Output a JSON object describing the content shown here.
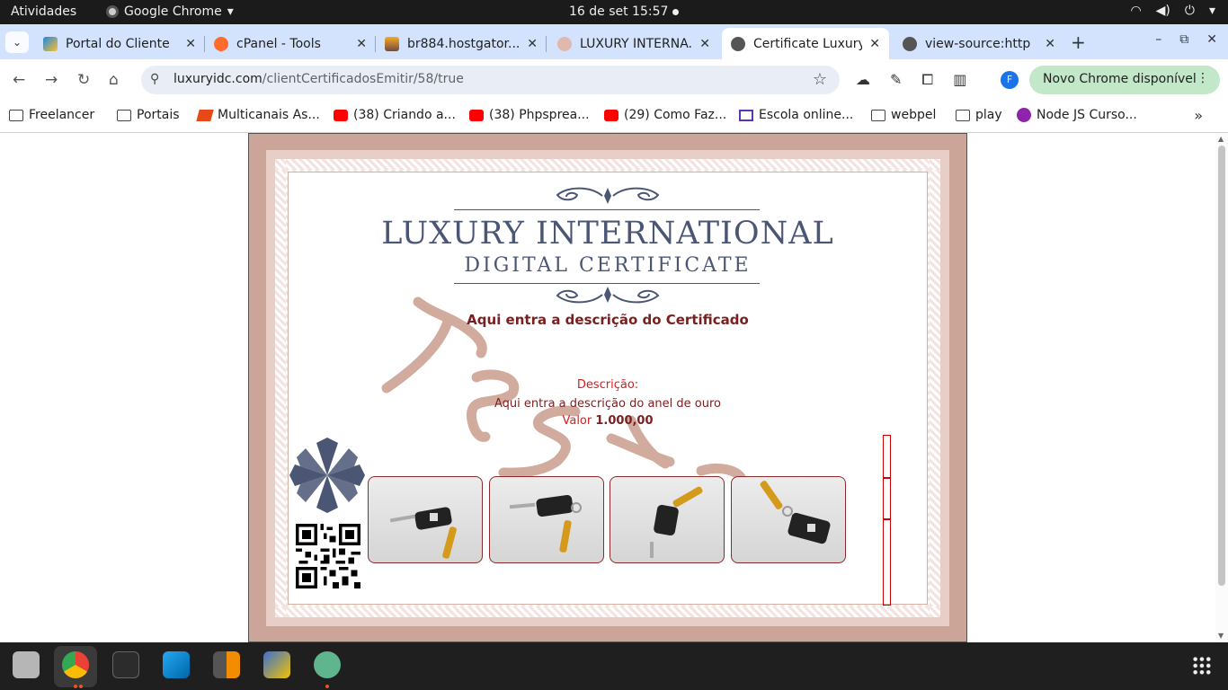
{
  "system_bar": {
    "activities": "Atividades",
    "app_name": "Google Chrome",
    "datetime": "16 de set  15:57"
  },
  "tabs": [
    {
      "title": "Portal do Cliente",
      "favicon": "hostgator-icon",
      "active": false
    },
    {
      "title": "cPanel - Tools",
      "favicon": "cpanel-icon",
      "active": false
    },
    {
      "title": "br884.hostgator...",
      "favicon": "phpmyadmin-icon",
      "active": false
    },
    {
      "title": "LUXURY INTERNA...",
      "favicon": "luxury-icon",
      "active": false
    },
    {
      "title": "Certificate Luxury",
      "favicon": "globe-icon",
      "active": true
    },
    {
      "title": "view-source:http",
      "favicon": "globe-icon",
      "active": false
    }
  ],
  "toolbar": {
    "url_host": "luxuryidc.com",
    "url_path": "/clientCertificadosEmitir/58/true",
    "profile_initial": "F",
    "update_label": "Novo Chrome disponível"
  },
  "bookmarks": [
    {
      "label": "Freelancer",
      "icon": "folder-icon"
    },
    {
      "label": "Portais",
      "icon": "folder-icon"
    },
    {
      "label": "Multicanais As...",
      "icon": "multicanais-icon"
    },
    {
      "label": "(38) Criando a...",
      "icon": "youtube-icon"
    },
    {
      "label": "(38) Phpsprea...",
      "icon": "youtube-icon"
    },
    {
      "label": "(29) Como Faz...",
      "icon": "youtube-icon"
    },
    {
      "label": "Escola online...",
      "icon": "escola-icon"
    },
    {
      "label": "webpel",
      "icon": "folder-icon"
    },
    {
      "label": "play",
      "icon": "folder-icon"
    },
    {
      "label": "Node JS Curso...",
      "icon": "node-icon"
    }
  ],
  "certificate": {
    "brand_title": "LUXURY INTERNATIONAL",
    "brand_subtitle": "DIGITAL CERTIFICATE",
    "description_heading": "Aqui entra a descrição do Certificado",
    "description_label": "Descrição:",
    "description_text": "Aqui entra a descrição do anel de ouro",
    "value_label": "Valor",
    "value_amount": "1.000,00",
    "watermark_text": "Teste",
    "photos": [
      "key-photo-1",
      "key-photo-2",
      "key-photo-3",
      "key-photo-4"
    ]
  },
  "colors": {
    "brand_navy": "#4a5674",
    "heading_red": "#7a1f1f",
    "label_red": "#d62020",
    "frame_rose": "#cba698",
    "update_green": "#c2e7c9"
  },
  "dock_apps": [
    "files-icon",
    "chrome-icon",
    "terminal-icon",
    "vscode-icon",
    "calculator-icon",
    "network-icon",
    "atom-icon",
    "apps-grid-icon"
  ]
}
